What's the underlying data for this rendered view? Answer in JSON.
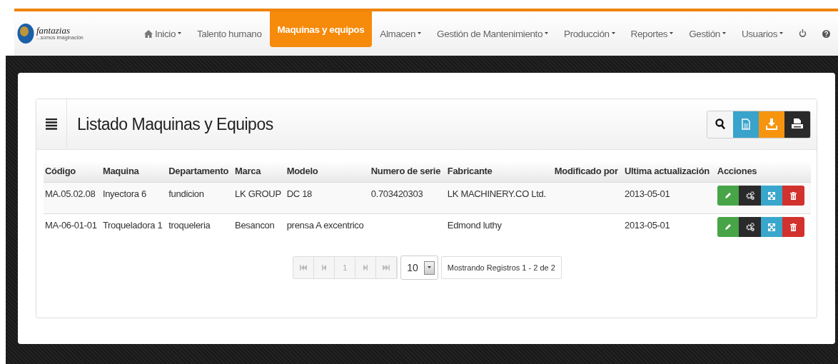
{
  "logo": {
    "name": "fantazias",
    "tagline": "...somos imaginación"
  },
  "nav": {
    "items": [
      {
        "label": "Inicio",
        "kind": "home",
        "dropdown": true,
        "selected": false
      },
      {
        "label": "Talento humano",
        "kind": "link",
        "dropdown": false,
        "selected": false
      },
      {
        "label": "Maquinas y equipos",
        "kind": "link",
        "dropdown": false,
        "selected": true
      },
      {
        "label": "Almacen",
        "kind": "link",
        "dropdown": true,
        "selected": false
      },
      {
        "label": "Gestión de Mantenimiento",
        "kind": "link",
        "dropdown": true,
        "selected": false
      },
      {
        "label": "Producción",
        "kind": "link",
        "dropdown": true,
        "selected": false
      },
      {
        "label": "Reportes",
        "kind": "link",
        "dropdown": true,
        "selected": false
      },
      {
        "label": "Gestión",
        "kind": "link",
        "dropdown": true,
        "selected": false
      },
      {
        "label": "Usuarios",
        "kind": "link",
        "dropdown": true,
        "selected": false
      },
      {
        "kind": "power",
        "dropdown": false,
        "selected": false
      },
      {
        "kind": "help",
        "dropdown": false,
        "selected": false
      }
    ]
  },
  "panel": {
    "title": "Listado Maquinas y Equipos",
    "tools": [
      {
        "kind": "search"
      },
      {
        "kind": "document"
      },
      {
        "kind": "download"
      },
      {
        "kind": "print"
      }
    ]
  },
  "table": {
    "columns": [
      "Código",
      "Maquina",
      "Departamento",
      "Marca",
      "Modelo",
      "Numero de serie",
      "Fabricante",
      "Modificado por",
      "Ultima actualización",
      "Acciones"
    ],
    "rows": [
      {
        "cells": [
          "MA.05.02.08",
          "Inyectora 6",
          "fundicion",
          "LK GROUP",
          "DC 18",
          "0.703420303",
          "LK MACHINERY.CO Ltd.",
          "",
          "2013-05-01"
        ],
        "actions": [
          {
            "kind": "edit"
          },
          {
            "kind": "settings"
          },
          {
            "kind": "expand"
          },
          {
            "kind": "delete"
          }
        ]
      },
      {
        "cells": [
          "MA-06-01-01",
          "Troqueladora 1",
          "troqueleria",
          "Besancon",
          "prensa A excentrico",
          "",
          "Edmond luthy",
          "",
          "2013-05-01"
        ],
        "actions": [
          {
            "kind": "edit"
          },
          {
            "kind": "settings"
          },
          {
            "kind": "expand"
          },
          {
            "kind": "delete"
          }
        ]
      }
    ]
  },
  "pagination": {
    "buttons": [
      {
        "kind": "first"
      },
      {
        "kind": "prev"
      },
      {
        "kind": "page",
        "label": "1"
      },
      {
        "kind": "next"
      },
      {
        "kind": "last"
      }
    ],
    "page_size": "10",
    "info": "Mostrando Registros 1 - 2 de 2"
  }
}
